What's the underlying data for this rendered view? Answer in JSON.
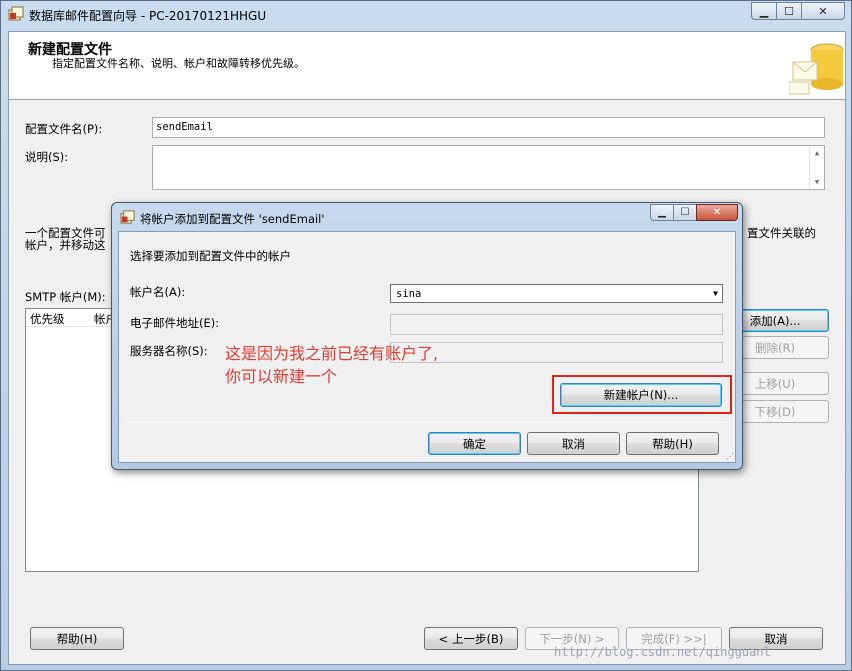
{
  "window": {
    "title": "数据库邮件配置向导 - PC-20170121HHGU",
    "minimize_glyph": "▭",
    "maximize_glyph": "☐",
    "close_glyph": "✕"
  },
  "header": {
    "title": "新建配置文件",
    "subtitle": "指定配置文件名称、说明、帐户和故障转移优先级。"
  },
  "form": {
    "profile_name_label": "配置文件名(P):",
    "profile_name_value": "sendEmail",
    "description_label": "说明(S):",
    "description_value": "",
    "info_text_line1_left": "一个配置文件可",
    "info_text_line2_left": "帐户，并移动这",
    "info_text_line1_right": "置文件关联的",
    "smtp_accounts_label": "SMTP 帐户(M):",
    "columns": [
      "优先级",
      "帐户"
    ]
  },
  "side_buttons": {
    "add": "添加(A)...",
    "delete": "删除(R)",
    "move_up": "上移(U)",
    "move_down": "下移(D)"
  },
  "footer": {
    "help": "帮助(H)",
    "back": "< 上一步(B)",
    "next": "下一步(N) >",
    "finish": "完成(F) >>|",
    "cancel": "取消"
  },
  "watermark": "http://blog.csdn.net/qingguanl",
  "dialog": {
    "title": "将帐户添加到配置文件 'sendEmail'",
    "instruction": "选择要添加到配置文件中的帐户",
    "account_name_label": "帐户名(A):",
    "account_name_value": "sina",
    "email_label": "电子邮件地址(E):",
    "email_value": "",
    "server_label": "服务器名称(S):",
    "server_value": "",
    "annotation_line1": "这是因为我之前已经有账户了,",
    "annotation_line2": "你可以新建一个",
    "new_account_button": "新建帐户(N)...",
    "ok": "确定",
    "cancel": "取消",
    "help": "帮助(H)"
  },
  "colors": {
    "annotation": "#e03c31",
    "highlight_box": "#e0241b"
  }
}
